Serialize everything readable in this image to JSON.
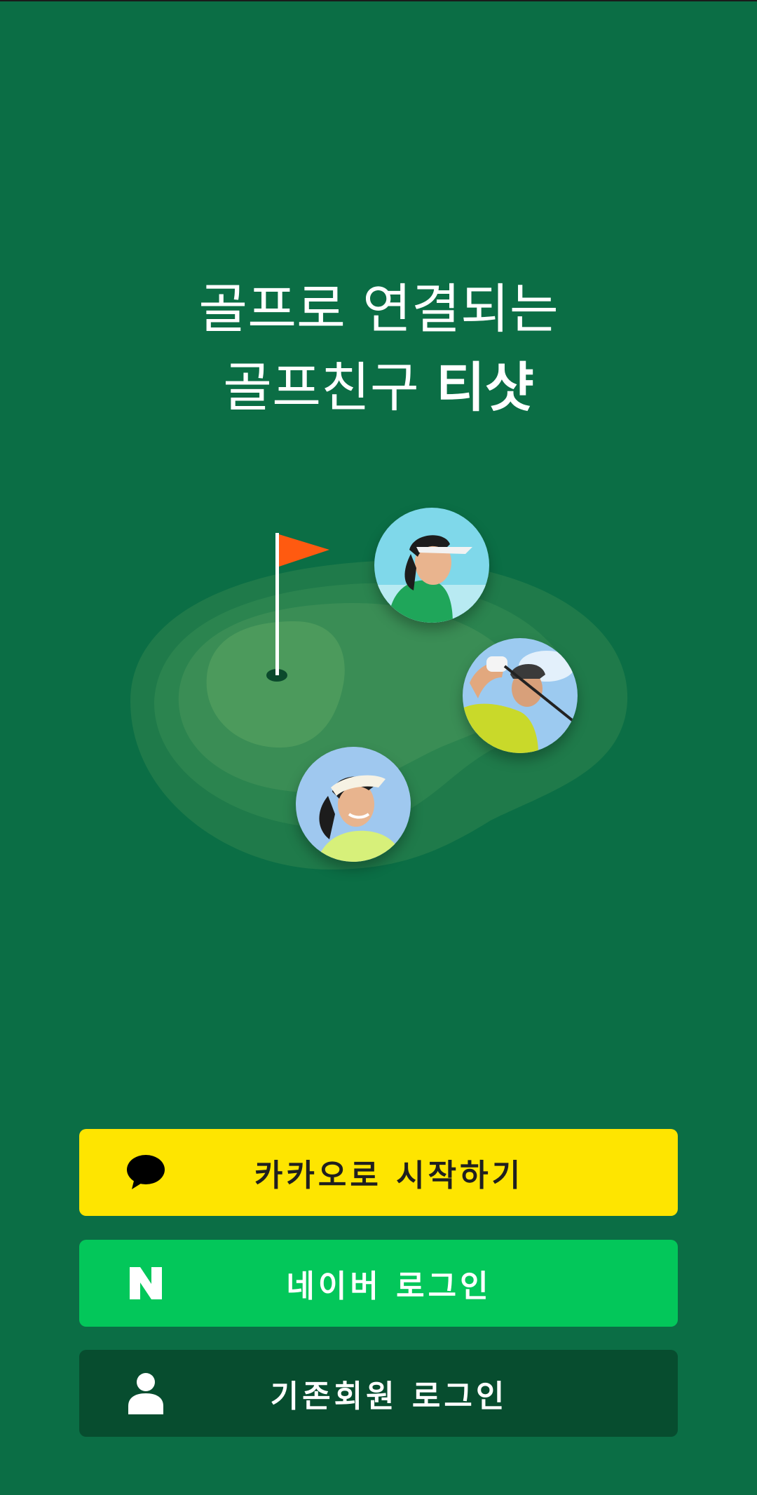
{
  "headline": {
    "line1": "골프로 연결되는",
    "line2_prefix": "골프친구 ",
    "line2_brand": "티샷"
  },
  "illustration": {
    "flag_color": "#ff5a10",
    "green_colors": [
      "#1f7a4a",
      "#2b844f",
      "#3a8d55",
      "#4c9a5c"
    ],
    "avatars": [
      "golfer-woman-visor",
      "golfer-man-swing",
      "golfer-woman-smiling"
    ]
  },
  "buttons": {
    "kakao": {
      "label": "카카오로 시작하기",
      "icon": "speech-bubble-icon",
      "color": "#fee500"
    },
    "naver": {
      "label": "네이버 로그인",
      "icon": "naver-n-icon",
      "color": "#03c75a"
    },
    "member": {
      "label": "기존회원 로그인",
      "icon": "user-icon",
      "color": "#074d2f"
    }
  }
}
